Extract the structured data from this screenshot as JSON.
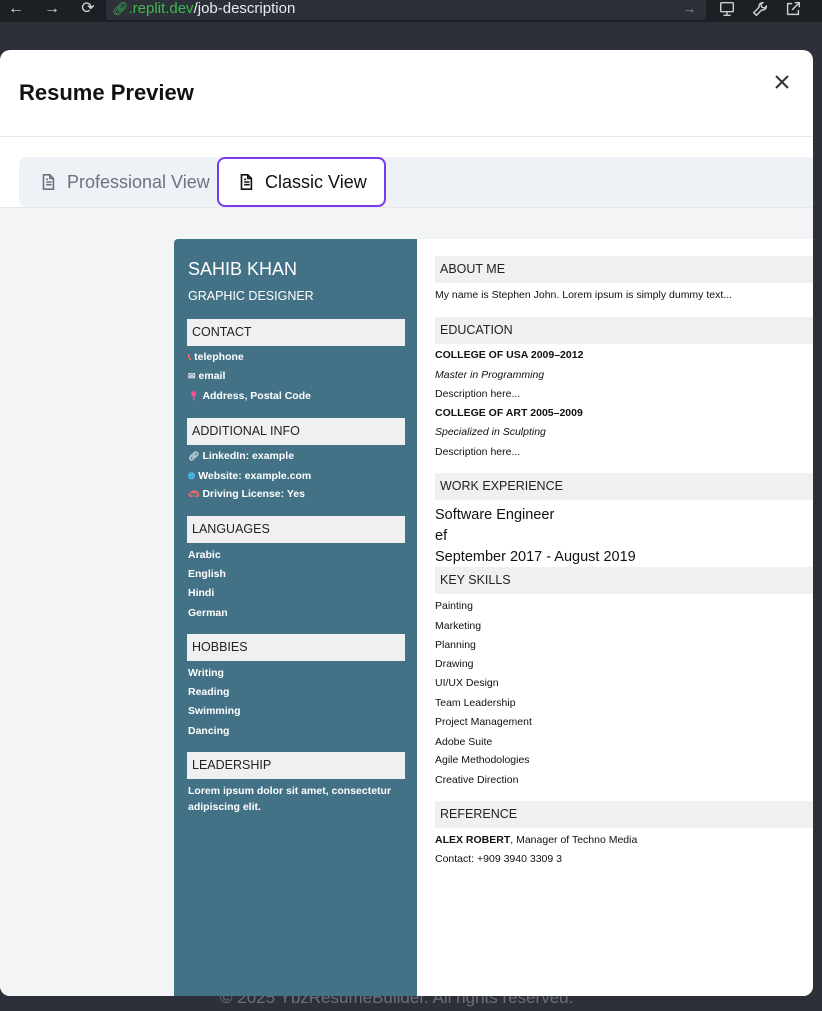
{
  "browser": {
    "url_domain": ".replit.dev",
    "url_path": "/job-description"
  },
  "footer_text": "© 2025 YbzResumeBuilder. All rights reserved.",
  "modal": {
    "title": "Resume Preview",
    "tabs": [
      {
        "label": "Professional View",
        "active": false
      },
      {
        "label": "Classic View",
        "active": true
      }
    ],
    "accent_color": "#7c3aed"
  },
  "resume": {
    "sidebar_color": "#437286",
    "name": "SAHIB KHAN",
    "role": "GRAPHIC DESIGNER",
    "contact": {
      "heading": "CONTACT",
      "items": [
        {
          "icon": "phone-icon",
          "text": "telephone"
        },
        {
          "icon": "mail-icon",
          "text": "email"
        },
        {
          "icon": "pin-icon",
          "text": "Address, Postal Code"
        }
      ]
    },
    "additional": {
      "heading": "ADDITIONAL INFO",
      "items": [
        {
          "icon": "link-icon",
          "text": "LinkedIn: example"
        },
        {
          "icon": "globe-icon",
          "text": "Website: example.com"
        },
        {
          "icon": "car-icon",
          "text": "Driving License: Yes"
        }
      ]
    },
    "languages": {
      "heading": "LANGUAGES",
      "items": [
        "Arabic",
        "English",
        "Hindi",
        "German"
      ]
    },
    "hobbies": {
      "heading": "HOBBIES",
      "items": [
        "Writing",
        "Reading",
        "Swimming",
        "Dancing"
      ]
    },
    "leadership": {
      "heading": "LEADERSHIP",
      "text": "Lorem ipsum dolor sit amet, consectetur adipiscing elit."
    },
    "about": {
      "heading": "ABOUT ME",
      "text": "My name is Stephen John. Lorem ipsum is simply dummy text..."
    },
    "education": {
      "heading": "EDUCATION",
      "entries": [
        {
          "school": "COLLEGE OF USA 2009–2012",
          "degree": "Master in Programming",
          "desc": "Description here..."
        },
        {
          "school": "COLLEGE OF ART 2005–2009",
          "degree": "Specialized in Sculpting",
          "desc": "Description here..."
        }
      ]
    },
    "work": {
      "heading": "WORK EXPERIENCE",
      "title": "Software Engineer",
      "company": "ef",
      "dates": "September 2017 - August 2019"
    },
    "skills": {
      "heading": "KEY SKILLS",
      "items": [
        "Painting",
        "Marketing",
        "Planning",
        "Drawing",
        "UI/UX Design",
        "Team Leadership",
        "Project Management",
        "Adobe Suite",
        "Agile Methodologies",
        "Creative Direction"
      ]
    },
    "reference": {
      "heading": "REFERENCE",
      "name": "ALEX ROBERT",
      "position": ", Manager of Techno Media",
      "contact": "Contact: +909 3940 3309 3"
    }
  }
}
